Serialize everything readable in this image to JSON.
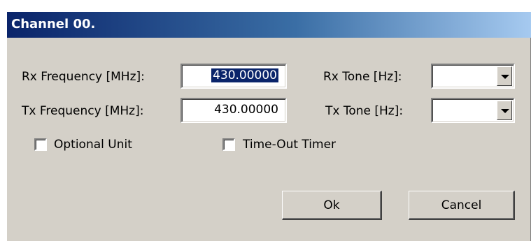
{
  "dialog": {
    "title": "Channel 00.",
    "rx_frequency": {
      "label": "Rx Frequency [MHz]:",
      "value": "430.00000"
    },
    "tx_frequency": {
      "label": "Tx Frequency [MHz]:",
      "value": "430.00000"
    },
    "rx_tone": {
      "label": "Rx Tone [Hz]:",
      "value": ""
    },
    "tx_tone": {
      "label": "Tx Tone [Hz]:",
      "value": ""
    },
    "optional_unit": {
      "label": "Optional Unit",
      "checked": false
    },
    "timeout_timer": {
      "label": "Time-Out Timer",
      "checked": false
    },
    "ok_label": "Ok",
    "cancel_label": "Cancel"
  }
}
